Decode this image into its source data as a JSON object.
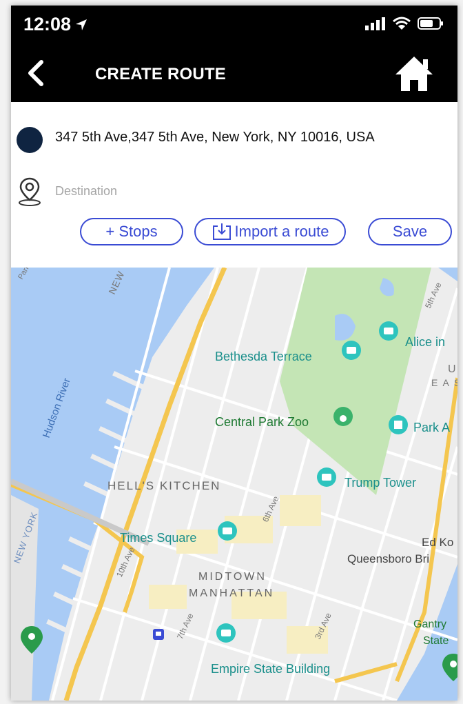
{
  "status_bar": {
    "time": "12:08"
  },
  "nav": {
    "title": "CREATE ROUTE"
  },
  "route_form": {
    "origin": "347 5th Ave,347 5th Ave, New York, NY 10016, USA",
    "destination_placeholder": "Destination",
    "stops_label": "+ Stops",
    "import_label": "Import a route",
    "save_label": "Save"
  },
  "map": {
    "water_label": "Hudson River",
    "neighborhoods": [
      "HELL'S KITCHEN",
      "MIDTOWN",
      "MANHATTAN",
      "NEW YORK"
    ],
    "places": [
      "Bethesda Terrace",
      "Alice in",
      "Central Park Zoo",
      "Park A",
      "Trump Tower",
      "Times Square",
      "Ed Ko",
      "Queensboro Bri",
      "Gantry",
      "State",
      "Empire State Building"
    ],
    "streets": [
      "6th Ave",
      "10th Ave",
      "7th Ave",
      "3rd Ave",
      "5th Ave",
      "Park"
    ],
    "partial_labels": [
      "U",
      "E A S"
    ],
    "colors": {
      "water": "#a9cbf5",
      "park": "#c4e5b5",
      "highway": "#f4c64f",
      "land": "#ededed",
      "poi": "#2ec4be"
    }
  }
}
